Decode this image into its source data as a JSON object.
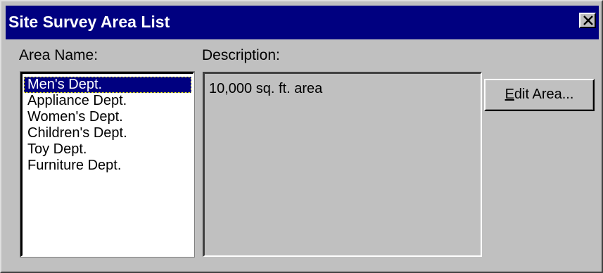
{
  "window": {
    "title": "Site Survey Area List",
    "close_glyph": "x-icon"
  },
  "area_name": {
    "label": "Area Name:",
    "items": [
      {
        "label": "Men's Dept.",
        "selected": true
      },
      {
        "label": "Appliance Dept.",
        "selected": false
      },
      {
        "label": "Women's Dept.",
        "selected": false
      },
      {
        "label": "Children's Dept.",
        "selected": false
      },
      {
        "label": "Toy Dept.",
        "selected": false
      },
      {
        "label": "Furniture Dept.",
        "selected": false
      }
    ]
  },
  "description": {
    "label": "Description:",
    "value": "10,000 sq. ft. area"
  },
  "edit_button": {
    "accel": "E",
    "rest": "dit Area..."
  },
  "colors": {
    "titlebar": "#000080",
    "face": "#c0c0c0",
    "selection": "#000080"
  }
}
